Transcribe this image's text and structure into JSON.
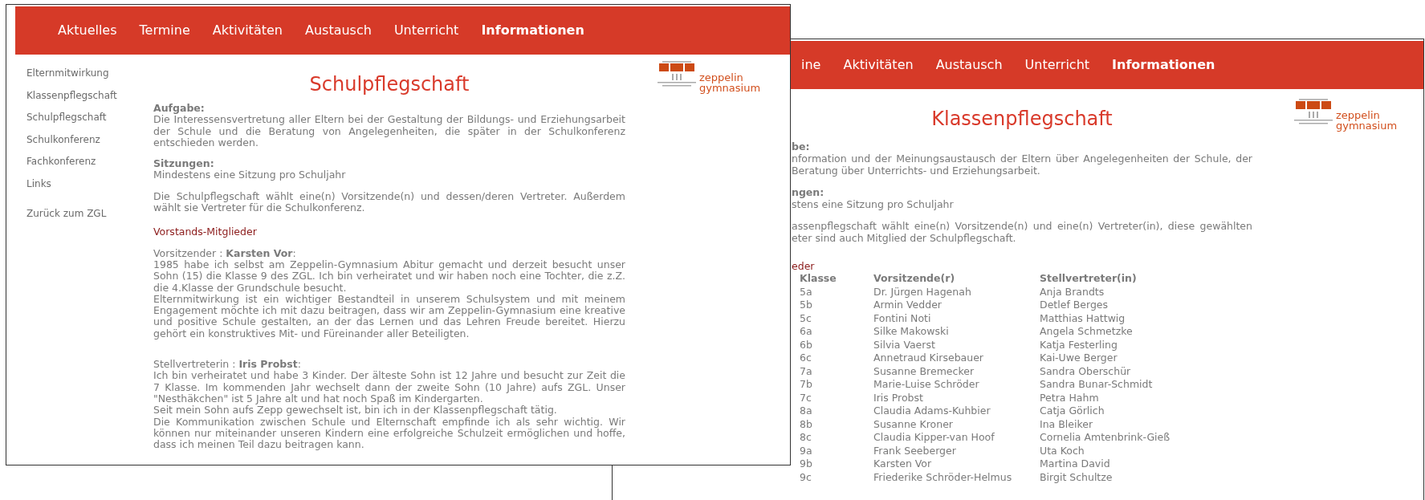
{
  "front_window": {
    "nav": [
      {
        "label": "Aktuelles",
        "selected": false
      },
      {
        "label": "Termine",
        "selected": false
      },
      {
        "label": "Aktivitäten",
        "selected": false
      },
      {
        "label": "Austausch",
        "selected": false
      },
      {
        "label": "Unterricht",
        "selected": false
      },
      {
        "label": "Informationen",
        "selected": true
      }
    ],
    "sidebar": {
      "items": [
        "Elternmitwirkung",
        "Klassenpflegschaft",
        "Schulpflegschaft",
        "Schulkonferenz",
        "Fachkonferenz",
        "Links"
      ],
      "back_link": "Zurück zum ZGL"
    },
    "logo": {
      "line1": "zeppelin",
      "line2": "gymnasium"
    },
    "title": "Schulpflegschaft",
    "blocks": [
      {
        "heading": "Aufgabe:",
        "text": "Die Interessensvertretung aller Eltern bei der Gestaltung der Bildungs- und Erziehungsarbeit der Schule und die Beratung von Angelegenheiten, die später in der Schulkonferenz entschieden werden."
      },
      {
        "heading": "Sitzungen:",
        "text": "Mindestens eine Sitzung pro Schuljahr"
      },
      {
        "text": "Die Schulpflegschaft wählt eine(n) Vorsitzende(n) und dessen/deren Vertreter. Außerdem wählt sie Vertreter für die Schulkonferenz."
      }
    ],
    "section_title": "Vorstands-Mitglieder",
    "members": [
      {
        "role": "Vorsitzender : **Karsten Vor**:",
        "paragraphs": [
          "1985 habe ich selbst am Zeppelin-Gymnasium Abitur gemacht und derzeit besucht unser Sohn (15) die Klasse 9 des ZGL. Ich bin verheiratet und wir haben noch eine Tochter, die z.Z. die 4.Klasse der Grundschule besucht.",
          "Elternmitwirkung ist ein wichtiger Bestandteil in unserem Schulsystem und mit meinem Engagement möchte ich mit dazu beitragen, dass wir am Zeppelin-Gymnasium eine kreative und positive Schule gestalten, an der das Lernen und das Lehren Freude bereitet. Hierzu gehört ein konstruktives Mit- und Füreinander aller Beteiligten."
        ]
      },
      {
        "role": "Stellvertreterin : **Iris Probst**:",
        "paragraphs": [
          "Ich bin verheiratet und habe 3 Kinder. Der älteste Sohn ist 12 Jahre und besucht zur Zeit die 7 Klasse. Im kommenden Jahr wechselt dann der zweite Sohn (10 Jahre) aufs ZGL. Unser \"Nesthäkchen\" ist 5 Jahre alt und hat noch Spaß im Kindergarten.",
          "Seit mein Sohn aufs Zepp gewechselt ist, bin ich in der Klassenpflegschaft tätig.",
          "Die Kommunikation zwischen Schule und Elternschaft empfinde ich als sehr wichtig. Wir können nur miteinander unseren Kindern eine erfolgreiche Schulzeit ermöglichen und hoffe, dass ich meinen Teil dazu beitragen kann."
        ]
      }
    ]
  },
  "back_window": {
    "nav": [
      {
        "label": "ine",
        "selected": false
      },
      {
        "label": "Aktivitäten",
        "selected": false
      },
      {
        "label": "Austausch",
        "selected": false
      },
      {
        "label": "Unterricht",
        "selected": false
      },
      {
        "label": "Informationen",
        "selected": true
      }
    ],
    "logo": {
      "line1": "zeppelin",
      "line2": "gymnasium"
    },
    "title": "Klassenpflegschaft",
    "blocks": [
      {
        "heading": "be:",
        "text": "nformation und der Meinungsaustausch der Eltern über Angelegenheiten der Schule, der Beratung über Unterrichts- und Erziehungsarbeit."
      },
      {
        "heading": "ngen:",
        "text": "stens eine Sitzung pro Schuljahr"
      },
      {
        "text": "assenpflegschaft wählt eine(n) Vorsitzende(n) und eine(n) Vertreter(in), diese gewählten eter sind auch Mitglied der Schulpflegschaft."
      }
    ],
    "section_title": "eder",
    "table": {
      "columns": [
        "Klasse",
        "Vorsitzende(r)",
        "Stellvertreter(in)"
      ],
      "rows": [
        [
          "5a",
          "Dr. Jürgen Hagenah",
          "Anja Brandts"
        ],
        [
          "5b",
          "Armin Vedder",
          "Detlef Berges"
        ],
        [
          "5c",
          "Fontini Noti",
          "Matthias Hattwig"
        ],
        [
          "6a",
          "Silke Makowski",
          "Angela Schmetzke"
        ],
        [
          "6b",
          "Silvia Vaerst",
          "Katja Festerling"
        ],
        [
          "6c",
          "Annetraud Kirsebauer",
          "Kai-Uwe Berger"
        ],
        [
          "7a",
          "Susanne Bremecker",
          "Sandra Oberschür"
        ],
        [
          "7b",
          "Marie-Luise Schröder",
          "Sandra Bunar-Schmidt"
        ],
        [
          "7c",
          "Iris Probst",
          "Petra Hahm"
        ],
        [
          "8a",
          "Claudia Adams-Kuhbier",
          "Catja Görlich"
        ],
        [
          "8b",
          "Susanne Kroner",
          "Ina Bleiker"
        ],
        [
          "8c",
          "Claudia Kipper-van Hoof",
          "Cornelia Amtenbrink-Gieß"
        ],
        [
          "9a",
          "Frank Seeberger",
          "Uta Koch"
        ],
        [
          "9b",
          "Karsten Vor",
          "Martina David"
        ],
        [
          "9c",
          "Friederike Schröder-Helmus",
          "Birgit Schultze"
        ]
      ]
    }
  }
}
